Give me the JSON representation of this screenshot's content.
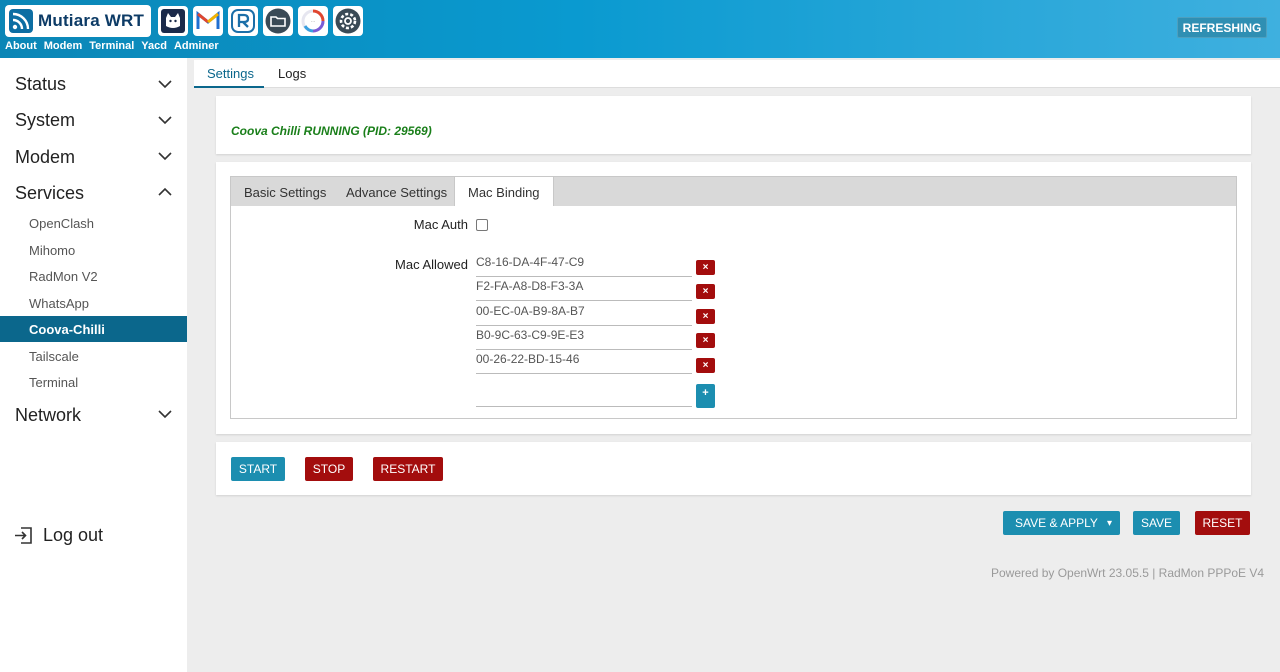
{
  "brand": {
    "name": "Mutiara WRT"
  },
  "toolbar_icons": [
    "cat-icon",
    "gmail-icon",
    "r-logo-icon",
    "folder-icon",
    "speedtest-icon",
    "settings-gear-icon"
  ],
  "topnav": [
    "About",
    "Modem",
    "Terminal",
    "Yacd",
    "Adminer"
  ],
  "refresh_label": "REFRESHING",
  "sidebar": {
    "status": "Status",
    "system": "System",
    "modem": "Modem",
    "services": "Services",
    "services_items": [
      "OpenClash",
      "Mihomo",
      "RadMon V2",
      "WhatsApp",
      "Coova-Chilli",
      "Tailscale",
      "Terminal"
    ],
    "network": "Network",
    "logout": "Log out"
  },
  "page_tabs": [
    "Settings",
    "Logs"
  ],
  "status_text": "Coova Chilli RUNNING (PID: 29569)",
  "inner_tabs": [
    "Basic Settings",
    "Advance Settings",
    "Mac Binding"
  ],
  "mac_auth": {
    "label": "Mac Auth",
    "checked": false
  },
  "mac_allowed": {
    "label": "Mac Allowed",
    "values": [
      "C8-16-DA-4F-47-C9",
      "F2-FA-A8-D8-F3-3A",
      "00-EC-0A-B9-8A-B7",
      "B0-9C-63-C9-9E-E3",
      "00-26-22-BD-15-46"
    ],
    "remove_symbol": "×",
    "add_symbol": "+"
  },
  "service_buttons": {
    "start": "START",
    "stop": "STOP",
    "restart": "RESTART"
  },
  "actions": {
    "save_apply": "SAVE & APPLY",
    "dropdown": "▾",
    "save": "SAVE",
    "reset": "RESET"
  },
  "footer": "Powered by OpenWrt 23.05.5 | RadMon PPPoE V4",
  "colors": {
    "accent": "#0b678c",
    "header": "#0a9ad0",
    "danger": "#a30d0d",
    "button": "#1c8eb0",
    "status": "#1a7f1a"
  }
}
